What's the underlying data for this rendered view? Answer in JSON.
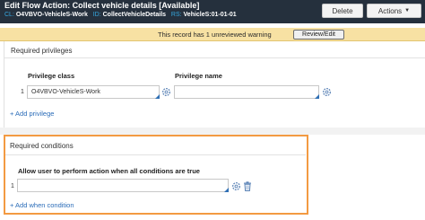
{
  "header": {
    "mode": "Edit",
    "title": "Flow Action: Collect vehicle details [Available]",
    "meta": [
      {
        "key": "CL:",
        "value": "O4VBVO-VehicleS-Work"
      },
      {
        "key": "ID:",
        "value": "CollectVehicleDetails"
      },
      {
        "key": "RS:",
        "value": "VehicleS:01-01-01"
      }
    ],
    "delete_label": "Delete",
    "actions_label": "Actions"
  },
  "warning": {
    "text": "This record has 1 unreviewed warning",
    "button_label": "Review/Edit"
  },
  "privileges": {
    "title": "Required privileges",
    "columns": [
      "Privilege class",
      "Privilege name"
    ],
    "rows": [
      {
        "num": "1",
        "class": "O4VBVO-VehicleS-Work",
        "name": ""
      }
    ],
    "add_label": "+ Add privilege"
  },
  "conditions": {
    "title": "Required conditions",
    "column": "Allow user to perform action when all conditions are true",
    "rows": [
      {
        "num": "1",
        "value": ""
      }
    ],
    "add_label": "+ Add when condition"
  },
  "colors": {
    "header_bg": "#25303d",
    "meta_key": "#35a8e0",
    "warning_bg": "#f7e1a3",
    "highlight_border": "#f39a42",
    "link": "#2a6cb8"
  }
}
